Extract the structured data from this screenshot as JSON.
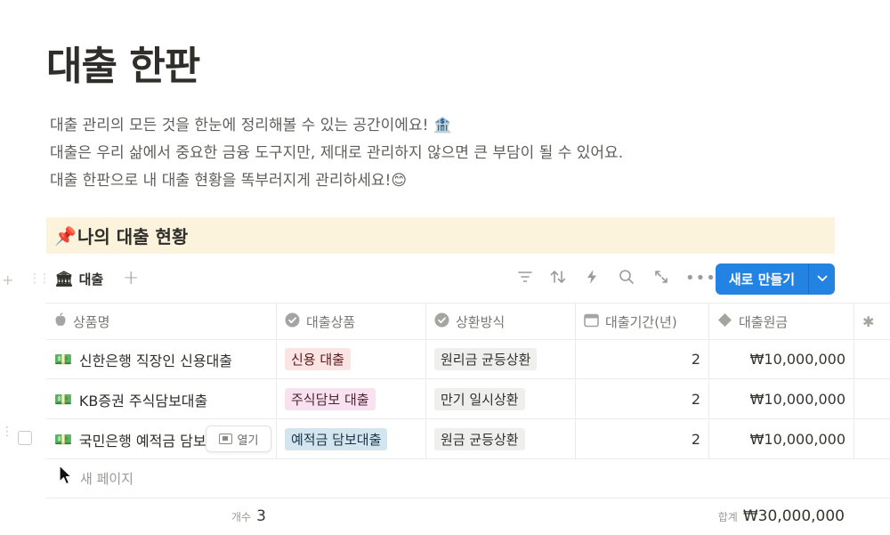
{
  "page": {
    "title": "대출 한판",
    "description": [
      "대출 관리의 모든 것을 한눈에 정리해볼 수 있는 공간이에요! 🏦",
      "대출은 우리 삶에서 중요한 금융 도구지만, 제대로 관리하지 않으면 큰 부담이 될 수 있어요.",
      "대출 한판으로 내 대출 현황을 똑부러지게 관리하세요!😊"
    ]
  },
  "callout": {
    "icon": "📌",
    "text": "나의 대출 현황"
  },
  "view": {
    "tab_icon": "🏛",
    "tab_label": "대출",
    "add_view": "+",
    "tools": [
      "filter-icon",
      "sort-icon",
      "automation-icon",
      "search-icon",
      "expand-icon",
      "more-icon"
    ],
    "new_button": "새로 만들기",
    "new_caret": "⌄"
  },
  "table": {
    "columns": [
      {
        "label": "상품명",
        "icon": "apple-icon",
        "glyph": ""
      },
      {
        "label": "대출상품",
        "icon": "select-icon",
        "glyph": "✔"
      },
      {
        "label": "상환방식",
        "icon": "select-icon",
        "glyph": "✔"
      },
      {
        "label": "대출기간(년)",
        "icon": "calendar-icon",
        "glyph": "▦"
      },
      {
        "label": "대출원금",
        "icon": "formula-icon",
        "glyph": "◆"
      },
      {
        "label": "",
        "icon": "asterisk-icon",
        "glyph": "✱"
      }
    ],
    "rows": [
      {
        "icon": "💵",
        "name": "신한은행 직장인 신용대출",
        "product": "신용 대출",
        "product_color": "red",
        "repay": "원리금 균등상환",
        "term": "2",
        "principal": "₩10,000,000"
      },
      {
        "icon": "💵",
        "name": "KB증권 주식담보대출",
        "product": "주식담보 대출",
        "product_color": "pink",
        "repay": "만기 일시상환",
        "term": "2",
        "principal": "₩10,000,000"
      },
      {
        "icon": "💵",
        "name": "국민은행 예적금 담보",
        "product": "예적금 담보대출",
        "product_color": "blue",
        "repay": "원금 균등상환",
        "term": "2",
        "principal": "₩10,000,000"
      }
    ],
    "open_label": "열기",
    "new_page_label": "새 페이지",
    "footer": {
      "count_label": "개수",
      "count_value": "3",
      "sum_label": "합계",
      "sum_value": "₩30,000,000"
    }
  }
}
